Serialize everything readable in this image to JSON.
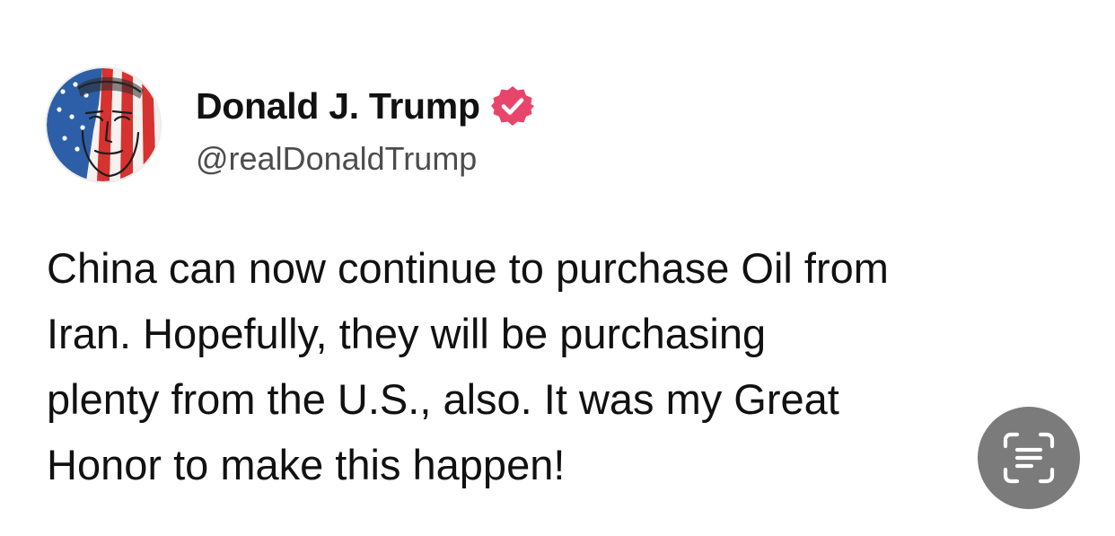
{
  "post": {
    "author": {
      "display_name": "Donald J. Trump",
      "handle": "@realDonaldTrump",
      "verified": true,
      "verified_badge_color": "#e8456b",
      "avatar_icon": "flag-portrait-avatar"
    },
    "text": "China can now continue to purchase Oil from\nIran. Hopefully, they will be purchasing\nplenty from the U.S., also. It was my Great\nHonor to make this happen!"
  },
  "overlay": {
    "live_text_button_icon": "live-text-scan-icon",
    "button_color": "#7b7b7b"
  }
}
